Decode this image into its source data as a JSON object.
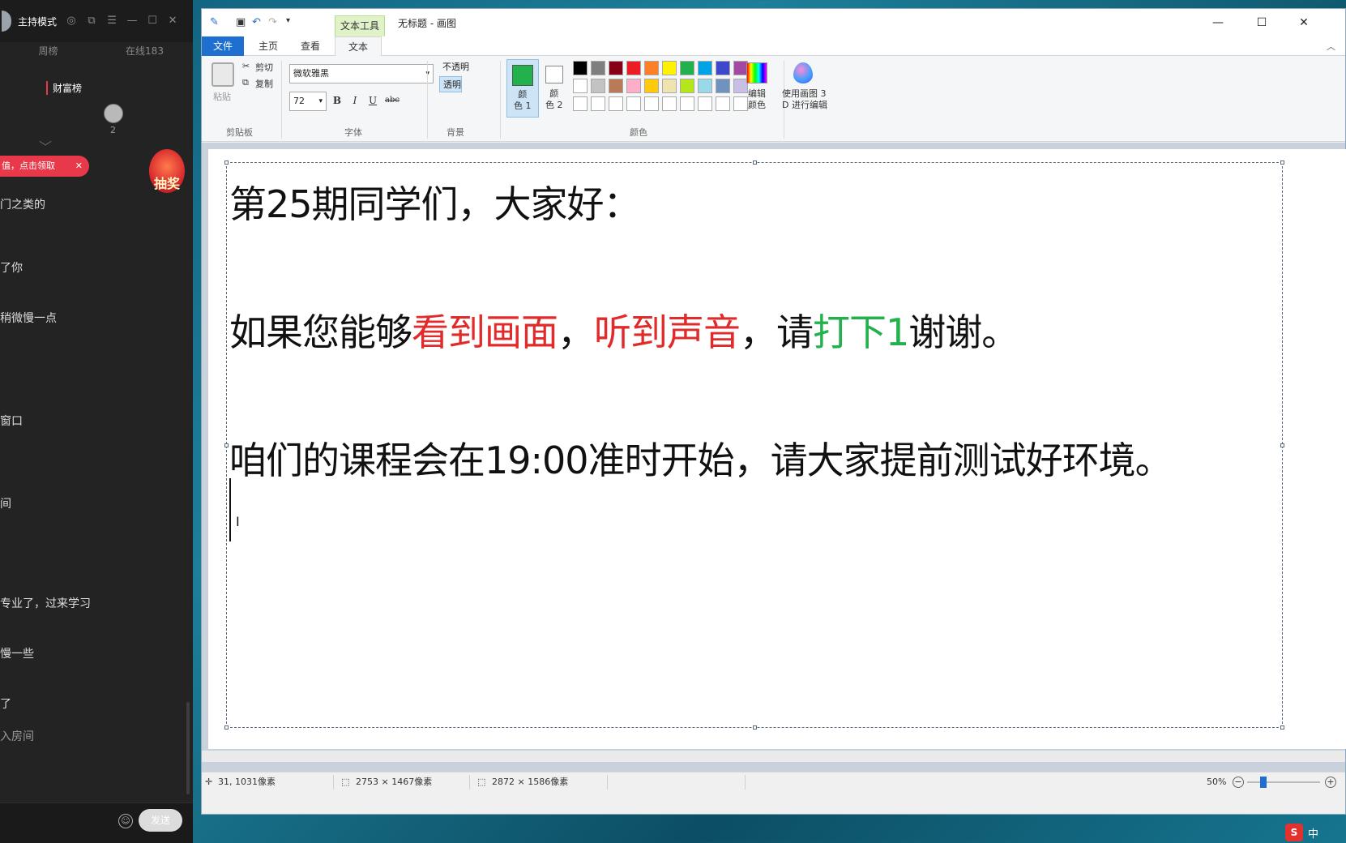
{
  "live_panel": {
    "title": "主持模式",
    "tabs": [
      "周榜",
      "在线183"
    ],
    "rich_list_label": "财富榜",
    "rich_count": "2",
    "pill_text": "值，点击领取",
    "lottery_label": "抽奖",
    "chat_lines": [
      "门之类的",
      "了你",
      "稍微慢一点",
      "窗口",
      "间",
      "专业了，过来学习",
      "慢一些",
      "了",
      "入房间"
    ],
    "send_label": "发送"
  },
  "window": {
    "context_tab": "文本工具",
    "title": "无标题 - 画图"
  },
  "tabs": [
    "文件",
    "主页",
    "查看",
    "文本"
  ],
  "ribbon": {
    "clipboard": {
      "paste": "粘贴",
      "cut": "剪切",
      "copy": "复制",
      "label": "剪贴板"
    },
    "font": {
      "family": "微软雅黑",
      "size": "72",
      "bold": "B",
      "italic": "I",
      "underline": "U",
      "strike": "abc",
      "label": "字体"
    },
    "background": {
      "opaque": "不透明",
      "transparent": "透明",
      "label": "背景"
    },
    "colors": {
      "color1_label": "颜\n色 1",
      "color2_label": "颜\n色 2",
      "edit_label": "编辑\n颜色",
      "paint3d_label": "使用画图 3\nD 进行编辑",
      "label": "颜色",
      "color1": "#22b14c",
      "color2": "#ffffff",
      "palette": [
        "#000000",
        "#7f7f7f",
        "#880015",
        "#ed1c24",
        "#ff7f27",
        "#fff200",
        "#22b14c",
        "#00a2e8",
        "#3f48cc",
        "#a349a4",
        "#ffffff",
        "#c3c3c3",
        "#b97a57",
        "#ffaec9",
        "#ffc90e",
        "#efe4b0",
        "#b5e61d",
        "#99d9ea",
        "#7092be",
        "#c8bfe7",
        "#ffffff",
        "#ffffff",
        "#ffffff",
        "#ffffff",
        "#ffffff",
        "#ffffff",
        "#ffffff",
        "#ffffff",
        "#ffffff",
        "#ffffff"
      ]
    }
  },
  "canvas_text": {
    "line1": "第25期同学们，大家好：",
    "line2": {
      "a": "如果您能够",
      "b": "看到画面",
      "c": "，",
      "d": "听到声音",
      "e": "，请",
      "f": "打下1",
      "g": "谢谢。"
    },
    "line3": "咱们的课程会在19:00准时开始，请大家提前测试好环境。"
  },
  "status": {
    "cursor": "31, 1031像素",
    "selection_size": "2753 × 1467像素",
    "image_size": "2872 × 1586像素",
    "zoom": "50%"
  },
  "tray": {
    "ime": "中"
  }
}
